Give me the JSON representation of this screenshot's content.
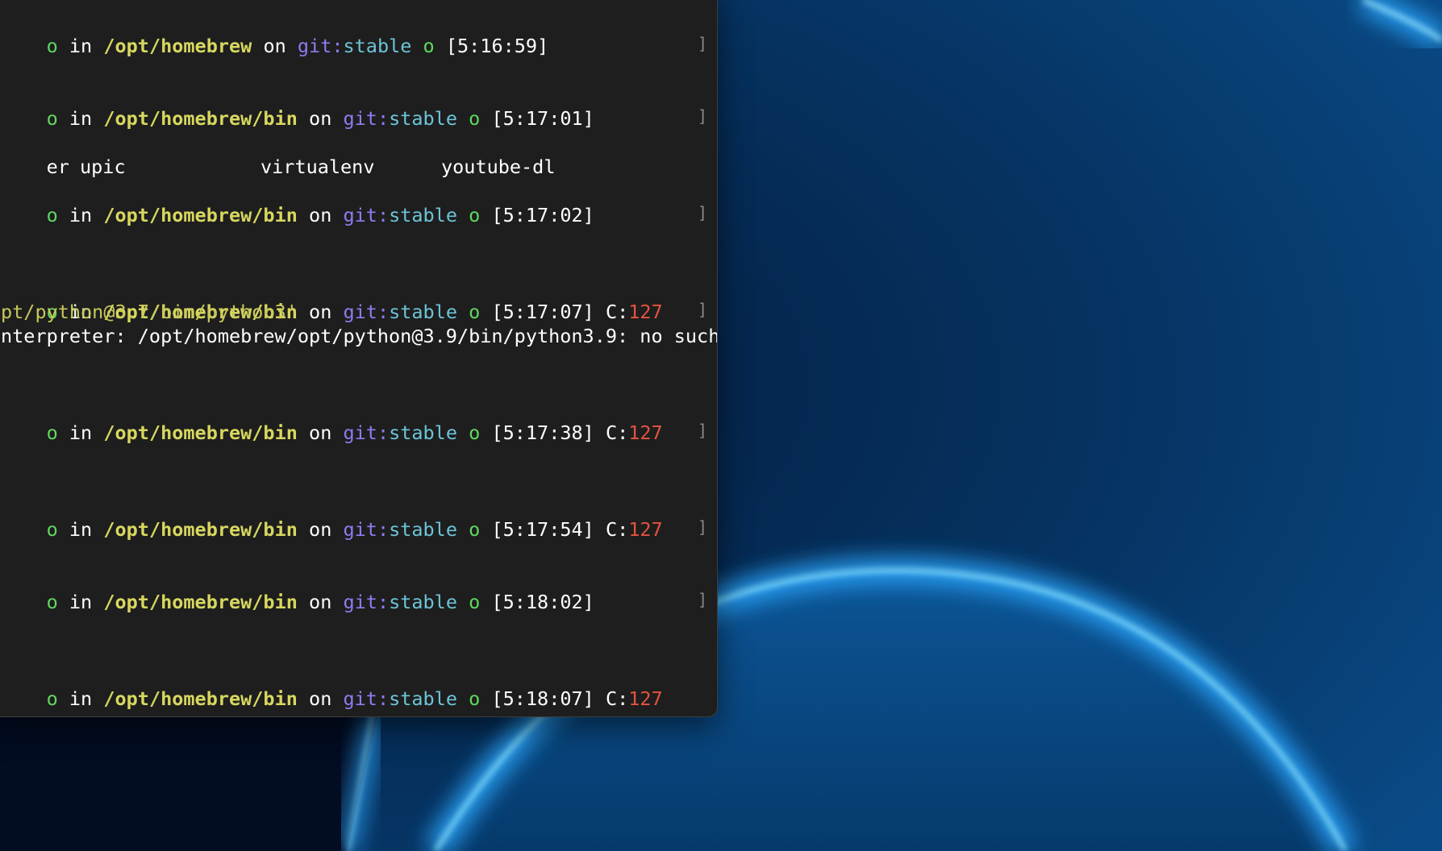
{
  "terminal": {
    "prompts": [
      {
        "mark": "o",
        "in": "in",
        "path": "/opt/homebrew",
        "on": "on",
        "git_prefix": "git:",
        "branch": "stable",
        "status": "o",
        "time": "[5:16:59]",
        "code_label": "",
        "code": ""
      },
      {
        "mark": "o",
        "in": "in",
        "path": "/opt/homebrew/bin",
        "on": "on",
        "git_prefix": "git:",
        "branch": "stable",
        "status": "o",
        "time": "[5:17:01]",
        "code_label": "",
        "code": ""
      },
      {
        "mark": "o",
        "in": "in",
        "path": "/opt/homebrew/bin",
        "on": "on",
        "git_prefix": "git:",
        "branch": "stable",
        "status": "o",
        "time": "[5:17:02]",
        "code_label": "",
        "code": ""
      },
      {
        "mark": "o",
        "in": "in",
        "path": "/opt/homebrew/bin",
        "on": "on",
        "git_prefix": "git:",
        "branch": "stable",
        "status": "o",
        "time": "[5:17:07]",
        "code_label": "C:",
        "code": "127"
      },
      {
        "mark": "o",
        "in": "in",
        "path": "/opt/homebrew/bin",
        "on": "on",
        "git_prefix": "git:",
        "branch": "stable",
        "status": "o",
        "time": "[5:17:38]",
        "code_label": "C:",
        "code": "127"
      },
      {
        "mark": "o",
        "in": "in",
        "path": "/opt/homebrew/bin",
        "on": "on",
        "git_prefix": "git:",
        "branch": "stable",
        "status": "o",
        "time": "[5:17:54]",
        "code_label": "C:",
        "code": "127"
      },
      {
        "mark": "o",
        "in": "in",
        "path": "/opt/homebrew/bin",
        "on": "on",
        "git_prefix": "git:",
        "branch": "stable",
        "status": "o",
        "time": "[5:18:02]",
        "code_label": "",
        "code": ""
      },
      {
        "mark": "o",
        "in": "in",
        "path": "/opt/homebrew/bin",
        "on": "on",
        "git_prefix": "git:",
        "branch": "stable",
        "status": "o",
        "time": "[5:18:07]",
        "code_label": "C:",
        "code": "127"
      }
    ],
    "ls_output": [
      "er",
      "upic",
      "virtualenv",
      "youtube-dl"
    ],
    "python_alias_line": "pt/python@3.7/bin/python3'",
    "error_line": "nterpreter: /opt/homebrew/opt/python@3.9/bin/python3.9: no such",
    "bracket_glyph": "]"
  },
  "colors": {
    "terminal_background": "#1e1e1e",
    "prompt_mark": "#5fd75f",
    "path": "#d7d75f",
    "git_prefix": "#8f7bf0",
    "branch": "#6cc4d8",
    "exit_code": "#e5533d",
    "wallpaper_base": "#062a55",
    "wallpaper_glow": "#35b8ff"
  }
}
